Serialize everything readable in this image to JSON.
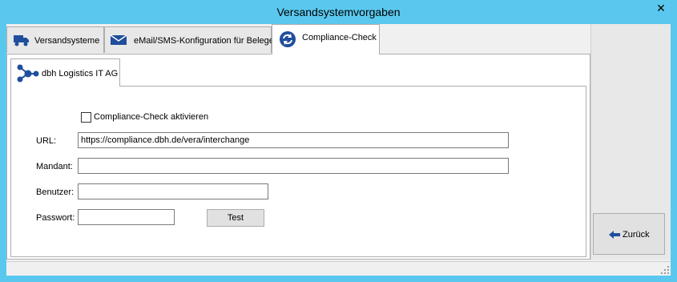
{
  "window": {
    "title": "Versandsystemvorgaben",
    "close_glyph": "✕"
  },
  "tabs": [
    {
      "label": "Versandsysteme",
      "icon": "truck-icon"
    },
    {
      "label": "eMail/SMS-Konfiguration für Belege",
      "icon": "envelope-icon"
    },
    {
      "label": "Compliance-Check",
      "icon": "refresh-icon",
      "active": true
    }
  ],
  "subtab": {
    "label": "dbh Logistics IT AG",
    "icon": "network-icon"
  },
  "form": {
    "activate_label": "Compliance-Check aktivieren",
    "activate_checked": false,
    "url_label": "URL:",
    "url_value": "https://compliance.dbh.de/vera/interchange",
    "mandant_label": "Mandant:",
    "mandant_value": "",
    "benutzer_label": "Benutzer:",
    "benutzer_value": "",
    "passwort_label": "Passwort:",
    "passwort_value": "",
    "test_button": "Test"
  },
  "side": {
    "back_button": "Zurück",
    "back_icon": "arrow-left-icon"
  },
  "colors": {
    "titlebar": "#5ac8ee",
    "accent_blue": "#1f4e9c"
  }
}
